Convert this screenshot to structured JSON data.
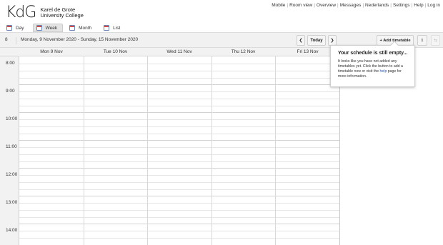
{
  "brand": {
    "mark": "KdG",
    "line1": "Karel de Grote",
    "line2": "University College"
  },
  "topnav": [
    "Mobile",
    "Room view",
    "Overview",
    "Messages",
    "Nederlands",
    "Settings",
    "Help",
    "Log in"
  ],
  "tabs": [
    {
      "label": "Day",
      "active": false
    },
    {
      "label": "Week",
      "active": true
    },
    {
      "label": "Month",
      "active": false
    },
    {
      "label": "List",
      "active": false
    }
  ],
  "toolbar": {
    "week_number": "8",
    "date_range": "Monday, 9 November 2020 - Sunday, 15 November 2020",
    "prev_label": "❮",
    "today_label": "Today",
    "next_label": "❯",
    "add_timetable_label": "+ Add timetable",
    "download_icon": "⤓",
    "share_icon": "⇆"
  },
  "days": [
    "Mon 9 Nov",
    "Tue 10 Nov",
    "Wed 11 Nov",
    "Thu 12 Nov",
    "Fri 13 Nov"
  ],
  "hours": [
    "8:00",
    "9:00",
    "10:00",
    "11:00",
    "12:00",
    "13:00",
    "14:00"
  ],
  "popover": {
    "title": "Your schedule is still empty...",
    "body_before": "It looks like you have not added any timetables yet. Click the button to add a timetable now or visit the ",
    "link": "help",
    "body_after": " page for more information."
  },
  "colors": {
    "link": "#2357b5",
    "header_bg": "#f2f2f2",
    "calendar_icon_red": "#d34d4d"
  }
}
